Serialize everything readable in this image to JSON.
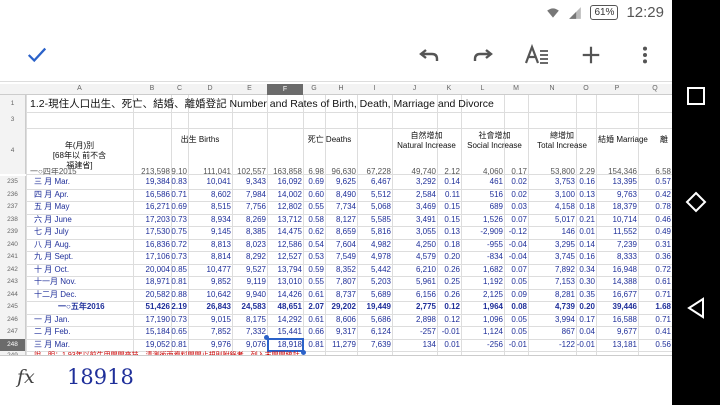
{
  "status": {
    "battery": "61%",
    "time": "12:29"
  },
  "toolbar": {
    "done": "check-icon",
    "undo": "undo-icon",
    "redo": "redo-icon",
    "format": "text-format-icon",
    "add": "plus-icon",
    "more": "more-icon"
  },
  "columns": [
    "A",
    "B",
    "C",
    "D",
    "E",
    "F",
    "G",
    "H",
    "I",
    "J",
    "K",
    "L",
    "M",
    "N",
    "O",
    "P",
    "Q"
  ],
  "selected_column": "F",
  "sheet_title": "1.2-現住人口出生、死亡、結婚、離婚登記 Number and Rates of Birth, Death, Marriage and Divorce",
  "headers": {
    "period": [
      "年(月)別",
      "[68年以 前不含",
      "福建省]"
    ],
    "births": "出生 Births",
    "deaths": "死亡 Deaths",
    "natural": [
      "自然增加",
      "Natural Increase"
    ],
    "social": [
      "社會增加",
      "Social Increase"
    ],
    "total": [
      "總增加",
      "Total Increase"
    ],
    "marriage": "結婚 Marriage",
    "divorce": "離"
  },
  "rows": [
    {
      "num": "235",
      "label": "三 月 Mar.",
      "vals": [
        "19,384",
        "0.83",
        "10,041",
        "9,343",
        "16,092",
        "0.69",
        "9,625",
        "6,467",
        "3,292",
        "0.14",
        "461",
        "0.02",
        "3,753",
        "0.16",
        "13,395",
        "0.57",
        "4."
      ]
    },
    {
      "num": "236",
      "label": "四 月 Apr.",
      "vals": [
        "16,586",
        "0.71",
        "8,602",
        "7,984",
        "14,002",
        "0.60",
        "8,490",
        "5,512",
        "2,584",
        "0.11",
        "516",
        "0.02",
        "3,100",
        "0.13",
        "9,763",
        "0.42",
        "4."
      ]
    },
    {
      "num": "237",
      "label": "五 月 May",
      "vals": [
        "16,271",
        "0.69",
        "8,515",
        "7,756",
        "12,802",
        "0.55",
        "7,734",
        "5,068",
        "3,469",
        "0.15",
        "689",
        "0.03",
        "4,158",
        "0.18",
        "18,379",
        "0.78",
        "4."
      ]
    },
    {
      "num": "238",
      "label": "六 月 June",
      "vals": [
        "17,203",
        "0.73",
        "8,934",
        "8,269",
        "13,712",
        "0.58",
        "8,127",
        "5,585",
        "3,491",
        "0.15",
        "1,526",
        "0.07",
        "5,017",
        "0.21",
        "10,714",
        "0.46",
        "4."
      ]
    },
    {
      "num": "239",
      "label": "七 月 July",
      "vals": [
        "17,530",
        "0.75",
        "9,145",
        "8,385",
        "14,475",
        "0.62",
        "8,659",
        "5,816",
        "3,055",
        "0.13",
        "-2,909",
        "-0.12",
        "146",
        "0.01",
        "11,552",
        "0.49",
        "5."
      ]
    },
    {
      "num": "240",
      "label": "八 月 Aug.",
      "vals": [
        "16,836",
        "0.72",
        "8,813",
        "8,023",
        "12,586",
        "0.54",
        "7,604",
        "4,982",
        "4,250",
        "0.18",
        "-955",
        "-0.04",
        "3,295",
        "0.14",
        "7,239",
        "0.31",
        "4."
      ]
    },
    {
      "num": "241",
      "label": "九 月 Sept.",
      "vals": [
        "17,106",
        "0.73",
        "8,814",
        "8,292",
        "12,527",
        "0.53",
        "7,549",
        "4,978",
        "4,579",
        "0.20",
        "-834",
        "-0.04",
        "3,745",
        "0.16",
        "8,333",
        "0.36",
        "4."
      ]
    },
    {
      "num": "242",
      "label": "十 月 Oct.",
      "vals": [
        "20,004",
        "0.85",
        "10,477",
        "9,527",
        "13,794",
        "0.59",
        "8,352",
        "5,442",
        "6,210",
        "0.26",
        "1,682",
        "0.07",
        "7,892",
        "0.34",
        "16,948",
        "0.72",
        "4."
      ]
    },
    {
      "num": "243",
      "label": "十一月 Nov.",
      "vals": [
        "18,971",
        "0.81",
        "9,852",
        "9,119",
        "13,010",
        "0.55",
        "7,807",
        "5,203",
        "5,961",
        "0.25",
        "1,192",
        "0.05",
        "7,153",
        "0.30",
        "14,388",
        "0.61",
        "4."
      ]
    },
    {
      "num": "244",
      "label": "十二月 Dec.",
      "vals": [
        "20,582",
        "0.88",
        "10,642",
        "9,940",
        "14,426",
        "0.61",
        "8,737",
        "5,689",
        "6,156",
        "0.26",
        "2,125",
        "0.09",
        "8,281",
        "0.35",
        "16,677",
        "0.71",
        "4."
      ]
    },
    {
      "num": "245",
      "label": "一○五年2016",
      "vals": [
        "51,426",
        "2.19",
        "26,843",
        "24,583",
        "48,651",
        "2.07",
        "29,202",
        "19,449",
        "2,775",
        "0.12",
        "1,964",
        "0.08",
        "4,739",
        "0.20",
        "39,446",
        "1.68",
        "12."
      ],
      "bold": true
    },
    {
      "num": "246",
      "label": "一 月 Jan.",
      "vals": [
        "17,190",
        "0.73",
        "9,015",
        "8,175",
        "14,292",
        "0.61",
        "8,606",
        "5,686",
        "2,898",
        "0.12",
        "1,096",
        "0.05",
        "3,994",
        "0.17",
        "16,588",
        "0.71",
        "3."
      ]
    },
    {
      "num": "247",
      "label": "二 月 Feb.",
      "vals": [
        "15,184",
        "0.65",
        "7,852",
        "7,332",
        "15,441",
        "0.66",
        "9,317",
        "6,124",
        "-257",
        "-0.01",
        "1,124",
        "0.05",
        "867",
        "0.04",
        "9,677",
        "0.41",
        "3."
      ]
    },
    {
      "num": "248",
      "label": "三 月 Mar.",
      "vals": [
        "19,052",
        "0.81",
        "9,976",
        "9,076",
        "18,918",
        "0.81",
        "11,279",
        "7,639",
        "134",
        "0.01",
        "-256",
        "-0.01",
        "-122",
        "-0.01",
        "13,181",
        "0.56",
        "5."
      ]
    }
  ],
  "partial_top_row": {
    "label": "一○四年2015",
    "vals": [
      "213,598",
      "9.10",
      "111,041",
      "102,557",
      "163,858",
      "6.98",
      "96,630",
      "67,228",
      "49,740",
      "2.12",
      "4,060",
      "0.17",
      "53,800",
      "2.29",
      "154,346",
      "6.58",
      "53,"
    ]
  },
  "footnote": {
    "num": "249",
    "text": "說　明：1.93年以前牛甲開開來技，清測術而資料開開止規則附錄者，列入末開開統計。"
  },
  "formula": {
    "fx": "fx",
    "value": "18918"
  },
  "row_numbers_top": [
    "1",
    "3",
    "4"
  ]
}
